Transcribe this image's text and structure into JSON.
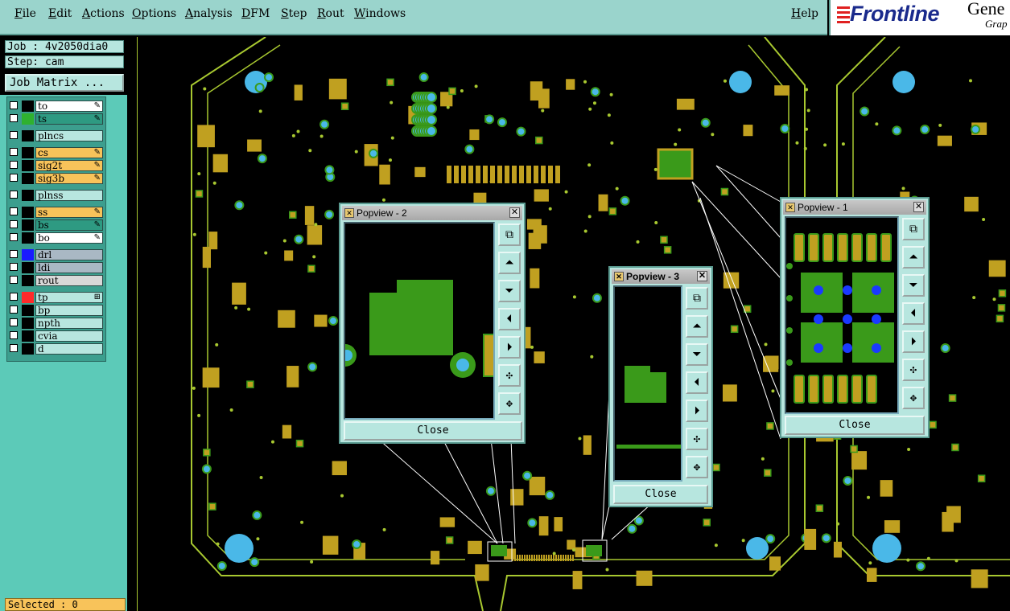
{
  "menubar": {
    "items": [
      "File",
      "Edit",
      "Actions",
      "Options",
      "Analysis",
      "DFM",
      "Step",
      "Rout",
      "Windows"
    ],
    "help": "Help"
  },
  "logo": {
    "brand": "Frontline",
    "product": "Gene",
    "subtitle": "Grap"
  },
  "left": {
    "job": "Job : 4v2050dia0",
    "step": "Step: cam",
    "job_matrix": "Job Matrix ..."
  },
  "layers": [
    {
      "name": "to",
      "color": "#ffffff",
      "swatch": "#000000",
      "mark": "✎"
    },
    {
      "name": "ts",
      "color": "#2e9a82",
      "swatch": "#2fb12f",
      "mark": "✎"
    },
    {
      "name": "plncs",
      "color": "#b7e6df",
      "swatch": "#000000",
      "mark": ""
    },
    {
      "name": "cs",
      "color": "#f8c35a",
      "swatch": "#000000",
      "mark": "✎"
    },
    {
      "name": "sig2t",
      "color": "#f8c35a",
      "swatch": "#000000",
      "mark": "✎"
    },
    {
      "name": "sig3b",
      "color": "#f8c35a",
      "swatch": "#000000",
      "mark": "✎"
    },
    {
      "name": "plnss",
      "color": "#b7e6df",
      "swatch": "#000000",
      "mark": ""
    },
    {
      "name": "ss",
      "color": "#f8c35a",
      "swatch": "#000000",
      "mark": "✎"
    },
    {
      "name": "bs",
      "color": "#2e9a82",
      "swatch": "#000000",
      "mark": "✎"
    },
    {
      "name": "bo",
      "color": "#ffffff",
      "swatch": "#000000",
      "mark": "✎"
    },
    {
      "name": "drl",
      "color": "#a9b8c4",
      "swatch": "#1a1aff",
      "mark": ""
    },
    {
      "name": "ldi",
      "color": "#a9b8c4",
      "swatch": "#000000",
      "mark": ""
    },
    {
      "name": "rout",
      "color": "#d8d8d8",
      "swatch": "#000000",
      "mark": ""
    },
    {
      "name": "tp",
      "color": "#b7e6df",
      "swatch": "#ff2a2a",
      "mark": "⊞"
    },
    {
      "name": "bp",
      "color": "#b7e6df",
      "swatch": "#000000",
      "mark": ""
    },
    {
      "name": "npth",
      "color": "#b7e6df",
      "swatch": "#000000",
      "mark": ""
    },
    {
      "name": "cvia",
      "color": "#b7e6df",
      "swatch": "#000000",
      "mark": ""
    },
    {
      "name": "d",
      "color": "#b7e6df",
      "swatch": "#000000",
      "mark": ""
    }
  ],
  "status": {
    "selected": "Selected : 0"
  },
  "popviews": [
    {
      "title": "Popview - 2",
      "close": "Close"
    },
    {
      "title": "Popview - 3",
      "close": "Close"
    },
    {
      "title": "Popview - 1",
      "close": "Close"
    }
  ],
  "toolbar_icons": [
    "zoom-window-icon",
    "pan-up-icon",
    "pan-down-icon",
    "pan-left-icon",
    "pan-right-icon",
    "zoom-in-icon",
    "zoom-out-icon"
  ],
  "colors": {
    "pad": "#c0a020",
    "green": "#3a9a1a",
    "via": "#4ab8e8",
    "trace": "#a8c830",
    "ui": "#b7e6df"
  }
}
